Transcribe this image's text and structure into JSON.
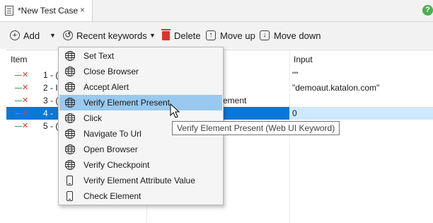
{
  "tab": {
    "title": "*New Test Case",
    "close_glyph": "×",
    "help_glyph": "?"
  },
  "toolbar": {
    "add_label": "Add",
    "recent_keywords_label": "Recent keywords",
    "delete_label": "Delete",
    "move_up_label": "Move up",
    "move_down_label": "Move down"
  },
  "table": {
    "columns": [
      "Item",
      "Input"
    ],
    "rows": [
      {
        "num": "1 - (",
        "input": "\"\""
      },
      {
        "num": "2 - I",
        "input": "\"demoaut.katalon.com\""
      },
      {
        "num": "3 - (",
        "obj": "ement",
        "input": ""
      },
      {
        "num": "4 -",
        "input": "0",
        "selected": true
      },
      {
        "num": "5 - (",
        "input": ""
      }
    ]
  },
  "menu": {
    "items": [
      {
        "label": "Set Text",
        "icon": "globe-icon"
      },
      {
        "label": "Close Browser",
        "icon": "globe-icon"
      },
      {
        "label": "Accept Alert",
        "icon": "globe-icon"
      },
      {
        "label": "Verify Element Present",
        "icon": "globe-icon",
        "highlighted": true
      },
      {
        "label": "Click",
        "icon": "globe-icon"
      },
      {
        "label": "Navigate To Url",
        "icon": "globe-icon"
      },
      {
        "label": "Open Browser",
        "icon": "globe-icon"
      },
      {
        "label": "Verify Checkpoint",
        "icon": "globe-icon"
      },
      {
        "label": "Verify Element Attribute Value",
        "icon": "mobile-icon"
      },
      {
        "label": "Check Element",
        "icon": "mobile-icon"
      }
    ]
  },
  "tooltip": {
    "text": "Verify Element Present (Web UI Keyword)"
  },
  "colors": {
    "selection": "#0a78d7",
    "menu_highlight": "#99c9ef",
    "delete_red": "#d9342b"
  }
}
